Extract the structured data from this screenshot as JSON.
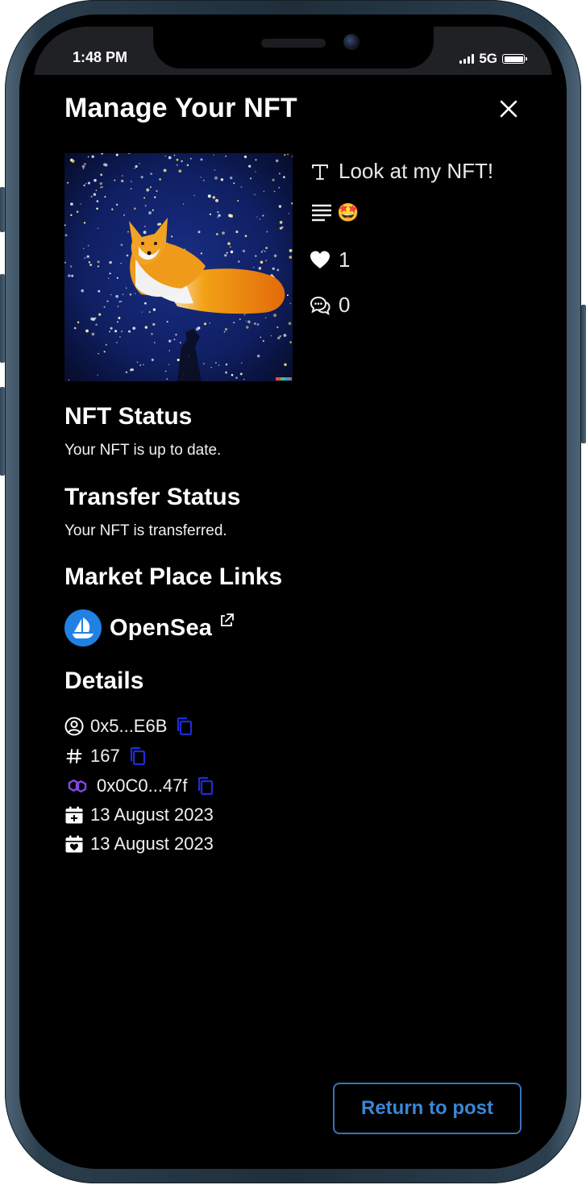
{
  "status_bar": {
    "time": "1:48 PM",
    "network": "5G",
    "signal_icon": "signal-bars-icon",
    "battery_icon": "battery-full-icon"
  },
  "page": {
    "title": "Manage Your NFT",
    "close_icon": "close-icon"
  },
  "nft": {
    "image_description_icon": "nft-fox-artwork",
    "title": "Look at my NFT!",
    "title_icon": "text-title-icon",
    "description_icon": "description-lines-icon",
    "description_emoji": "🤩",
    "likes": "1",
    "likes_icon": "heart-icon",
    "comments": "0",
    "comments_icon": "comment-bubbles-icon"
  },
  "sections": {
    "nft_status": {
      "heading": "NFT Status",
      "text": "Your NFT is up to date."
    },
    "transfer_status": {
      "heading": "Transfer Status",
      "text": "Your NFT is transferred."
    },
    "market_place": {
      "heading": "Market Place Links",
      "opensea_label": "OpenSea"
    },
    "details": {
      "heading": "Details",
      "owner": "0x5...E6B",
      "token_id": "167",
      "contract": "0x0C0...47f",
      "created_date": "13 August 2023",
      "updated_date": "13 August 2023"
    }
  },
  "actions": {
    "return_label": "Return to post"
  },
  "colors": {
    "background": "#000000",
    "status_bar": "#202124",
    "opensea_blue": "#2081e2",
    "copy_icon_blue": "#1f2bd6",
    "polygon_purple": "#8247e5",
    "return_button": "#3a86d6"
  }
}
